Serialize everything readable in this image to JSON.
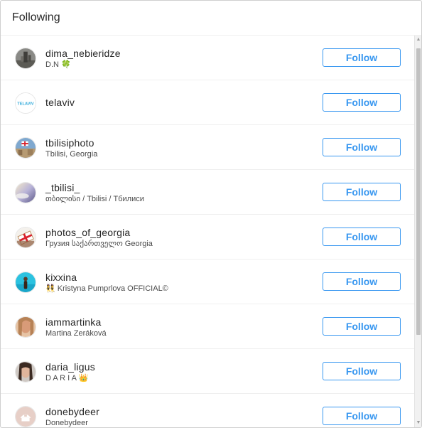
{
  "dialog": {
    "title": "Following",
    "follow_label": "Follow"
  },
  "users": [
    {
      "username": "dima_nebieridze",
      "fullname": "D.N 🍀",
      "avatar": "stone-tower-avatar"
    },
    {
      "username": "telaviv",
      "fullname": "",
      "avatar": "telaviv-logo-avatar",
      "logo_text": "TELAVIV"
    },
    {
      "username": "tbilisiphoto",
      "fullname": "Tbilisi, Georgia",
      "avatar": "city-flag-avatar"
    },
    {
      "username": "_tbilisi_",
      "fullname": "თბილისი / Tbilisi / Тбилиси",
      "avatar": "sky-avatar"
    },
    {
      "username": "photos_of_georgia",
      "fullname": "Грузия საქართველო Georgia",
      "avatar": "georgia-flag-avatar"
    },
    {
      "username": "kixxina",
      "fullname": "👯 Kristyna Pumprlova OFFICIAL©",
      "avatar": "beach-person-avatar"
    },
    {
      "username": "iammartinka",
      "fullname": "Martina Zeráková",
      "avatar": "portrait-avatar"
    },
    {
      "username": "daria_ligus",
      "fullname": "D A R I A 👑",
      "avatar": "portrait-dark-avatar"
    },
    {
      "username": "donebydeer",
      "fullname": "Donebydeer",
      "avatar": "deer-logo-avatar"
    }
  ],
  "colors": {
    "accent": "#3897f0",
    "text": "#262626",
    "subtext": "#4a4a4a",
    "divider": "#efefef"
  }
}
